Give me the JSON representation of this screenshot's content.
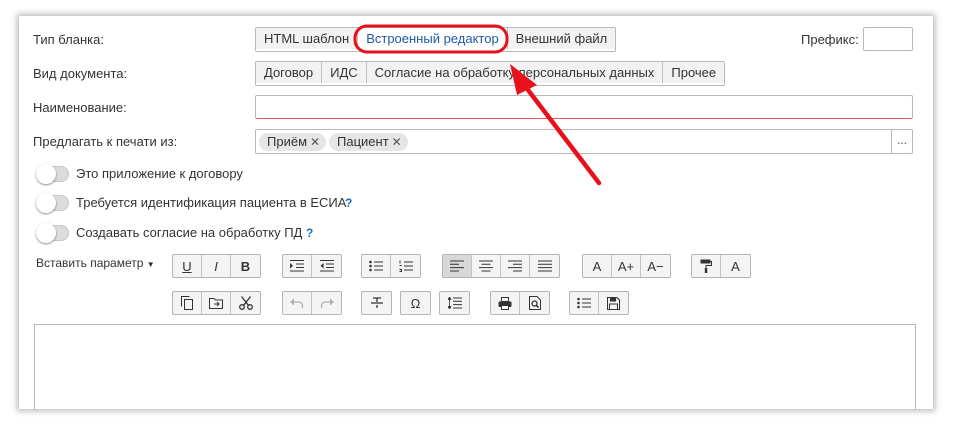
{
  "form": {
    "template_type_label": "Тип бланка:",
    "template_type_options": [
      "HTML шаблон",
      "Встроенный редактор",
      "Внешний файл"
    ],
    "prefix_label": "Префикс:",
    "prefix_value": "",
    "doc_kind_label": "Вид документа:",
    "doc_kind_options": [
      "Договор",
      "ИДС",
      "Согласие на обработку персональных данных",
      "Прочее"
    ],
    "name_label": "Наименование:",
    "name_value": "",
    "print_from_label": "Предлагать к печати из:",
    "print_from_tags": [
      "Приём",
      "Пациент"
    ],
    "tag_remove": "✕",
    "more_button": "...",
    "toggle_contract_label": "Это приложение к договору",
    "toggle_esia_label": "Требуется идентификация пациента в ЕСИА",
    "toggle_consent_label": "Создавать согласие на обработку ПД",
    "help_mark": "?",
    "insert_param_label": "Вставить параметр"
  },
  "toolbar": {
    "underline": "U",
    "italic": "I",
    "bold": "B",
    "font_normal": "A",
    "font_larger": "A+",
    "font_smaller": "A−",
    "text_color": "A",
    "special_char": "Ω"
  },
  "colors": {
    "accent_text": "#1f5aa8",
    "annotation_red": "#e8101a",
    "help_blue": "#1f6fc5"
  }
}
